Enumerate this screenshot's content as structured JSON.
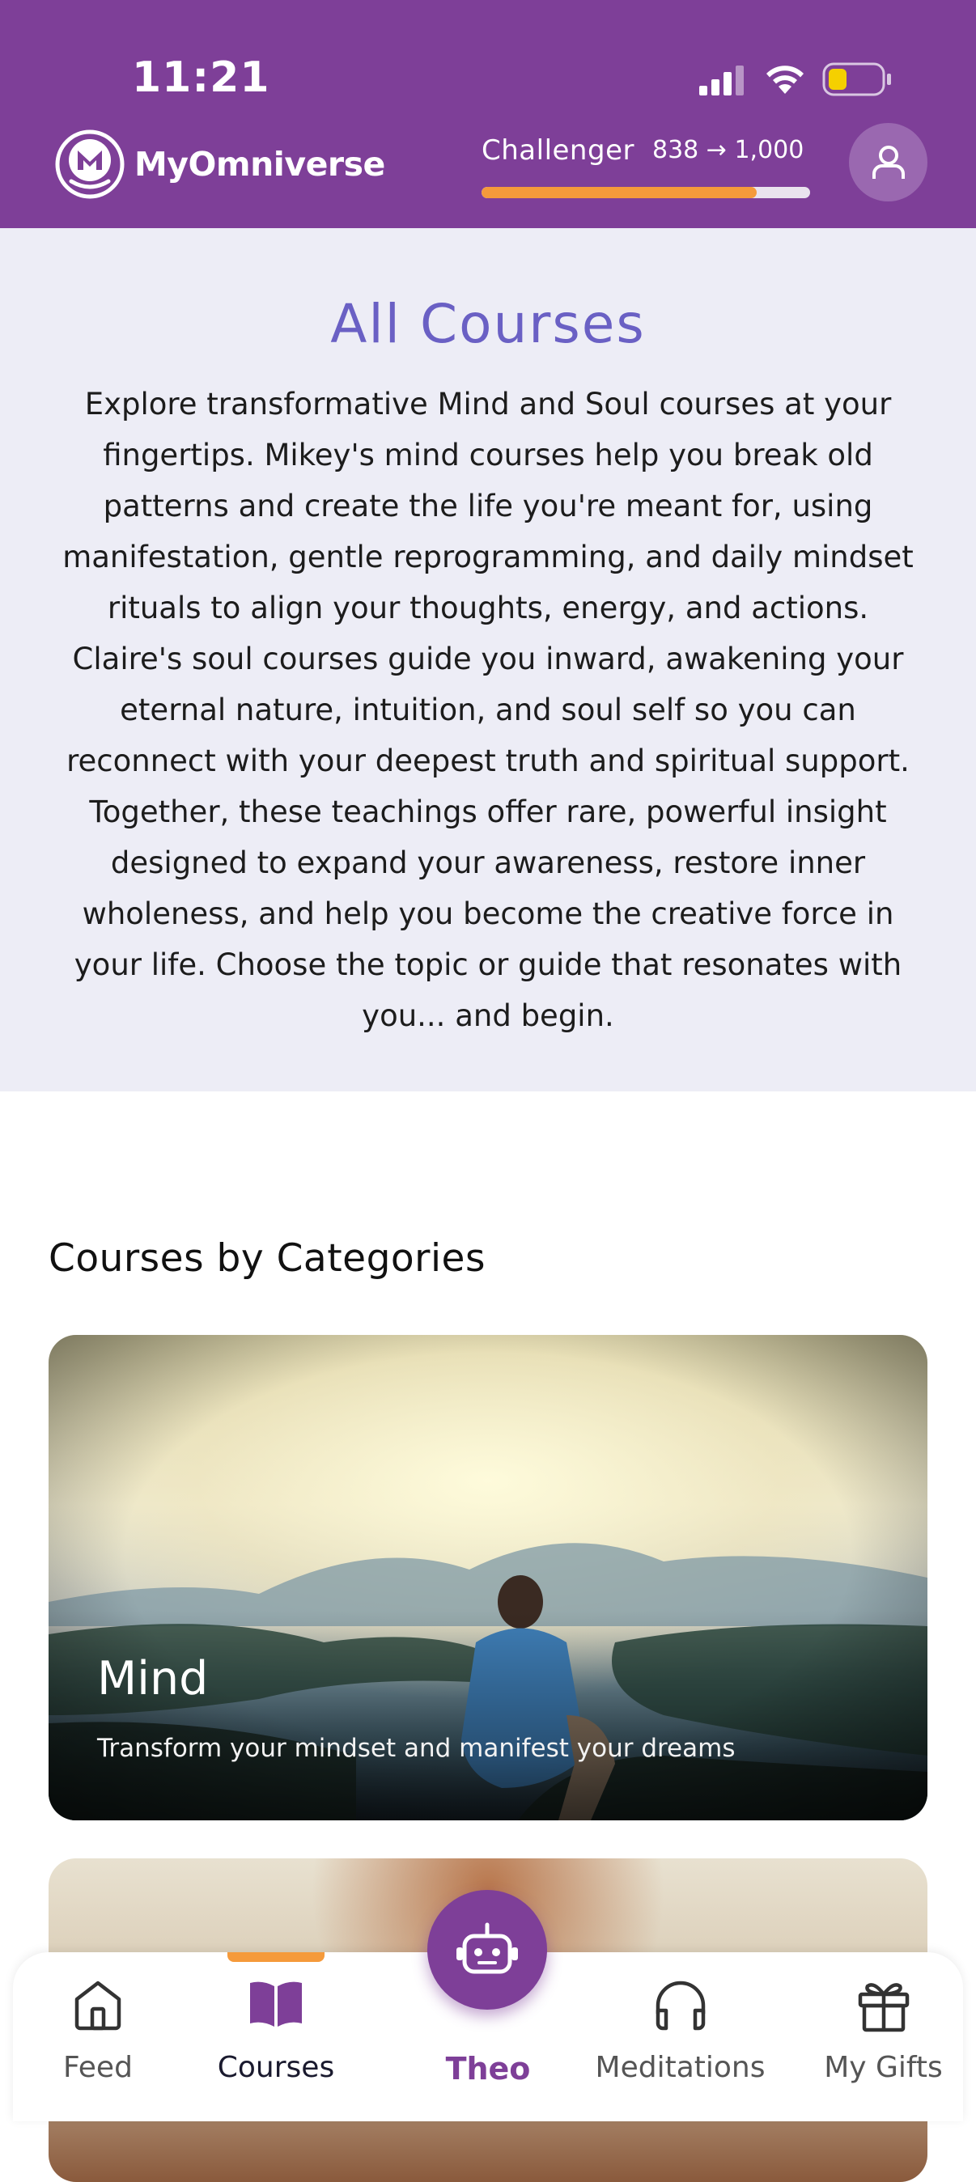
{
  "status_bar": {
    "time": "11:21",
    "icons": [
      "cellular-signal-icon",
      "wifi-icon",
      "battery-icon"
    ]
  },
  "header": {
    "brand": "MyOmniverse",
    "level": "Challenger",
    "points": "838 → 1,000",
    "progress_fraction": 0.838,
    "accent_color": "#7e3f98",
    "progress_color": "#f59a3b"
  },
  "intro": {
    "title": "All Courses",
    "description": "Explore transformative Mind and Soul courses at your fingertips. Mikey's mind courses help you break old patterns and create the life you're meant for, using manifestation, gentle reprogramming, and daily mindset rituals to align your thoughts, energy, and actions. Claire's soul courses guide you inward, awakening your eternal nature, intuition, and soul self so you can reconnect with your deepest truth and spiritual support. Together, these teachings offer rare, powerful insight designed to expand your awareness, restore inner wholeness, and help you become the creative force in your life. Choose the topic or guide that resonates with you... and begin."
  },
  "categories": {
    "heading": "Courses by Categories",
    "items": [
      {
        "title": "Mind",
        "subtitle": "Transform your mindset and manifest your dreams"
      }
    ]
  },
  "nav": {
    "items": [
      {
        "label": "Feed",
        "icon": "home-icon"
      },
      {
        "label": "Courses",
        "icon": "book-icon",
        "active": true
      },
      {
        "label": "Theo",
        "icon": "robot-icon"
      },
      {
        "label": "Meditations",
        "icon": "headphones-icon"
      },
      {
        "label": "My Gifts",
        "icon": "gift-icon"
      }
    ]
  }
}
